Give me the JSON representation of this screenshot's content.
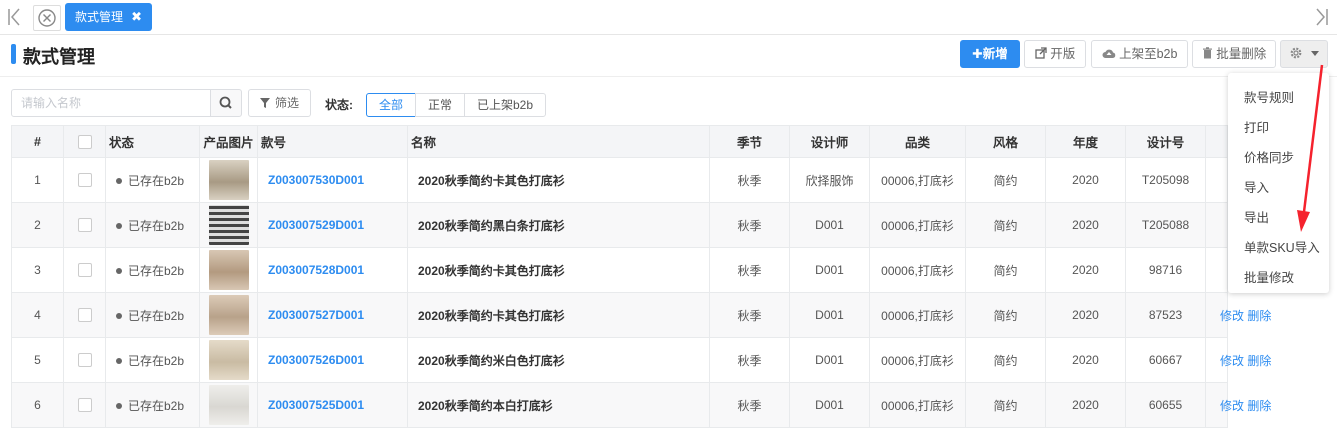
{
  "tabs": {
    "active_label": "款式管理"
  },
  "page": {
    "title": "款式管理"
  },
  "toolbar": {
    "add_label": "新增",
    "open_label": "开版",
    "upload_label": "上架至b2b",
    "batch_delete_label": "批量删除"
  },
  "filters": {
    "search_placeholder": "请输入名称",
    "filter_label": "筛选",
    "status_label": "状态:",
    "status_options": [
      "全部",
      "正常",
      "已上架b2b"
    ],
    "status_selected": "全部"
  },
  "dropdown": {
    "items": [
      "款号规则",
      "打印",
      "价格同步",
      "导入",
      "导出",
      "单款SKU导入",
      "批量修改"
    ]
  },
  "table": {
    "columns": [
      "#",
      "",
      "状态",
      "产品图片",
      "款号",
      "名称",
      "季节",
      "设计师",
      "品类",
      "风格",
      "年度",
      "设计号",
      ""
    ],
    "rows": [
      {
        "idx": "1",
        "status": "已存在b2b",
        "code": "Z003007530D001",
        "name": "2020秋季简约卡其色打底衫",
        "season": "秋季",
        "designer": "欣择服饰",
        "category": "00006,打底衫",
        "style": "简约",
        "year": "2020",
        "design_no": "T205098",
        "edit": "",
        "del": ""
      },
      {
        "idx": "2",
        "status": "已存在b2b",
        "code": "Z003007529D001",
        "name": "2020秋季简约黑白条打底衫",
        "season": "秋季",
        "designer": "D001",
        "category": "00006,打底衫",
        "style": "简约",
        "year": "2020",
        "design_no": "T205088",
        "edit": "",
        "del": ""
      },
      {
        "idx": "3",
        "status": "已存在b2b",
        "code": "Z003007528D001",
        "name": "2020秋季简约卡其色打底衫",
        "season": "秋季",
        "designer": "D001",
        "category": "00006,打底衫",
        "style": "简约",
        "year": "2020",
        "design_no": "98716",
        "edit": "",
        "del": ""
      },
      {
        "idx": "4",
        "status": "已存在b2b",
        "code": "Z003007527D001",
        "name": "2020秋季简约卡其色打底衫",
        "season": "秋季",
        "designer": "D001",
        "category": "00006,打底衫",
        "style": "简约",
        "year": "2020",
        "design_no": "87523",
        "edit": "修改",
        "del": "删除"
      },
      {
        "idx": "5",
        "status": "已存在b2b",
        "code": "Z003007526D001",
        "name": "2020秋季简约米白色打底衫",
        "season": "秋季",
        "designer": "D001",
        "category": "00006,打底衫",
        "style": "简约",
        "year": "2020",
        "design_no": "60667",
        "edit": "修改",
        "del": "删除"
      },
      {
        "idx": "6",
        "status": "已存在b2b",
        "code": "Z003007525D001",
        "name": "2020秋季简约本白打底衫",
        "season": "秋季",
        "designer": "D001",
        "category": "00006,打底衫",
        "style": "简约",
        "year": "2020",
        "design_no": "60655",
        "edit": "修改",
        "del": "删除"
      }
    ]
  },
  "colors": {
    "accent": "#2d8cf0",
    "arrow": "#f5222d"
  }
}
